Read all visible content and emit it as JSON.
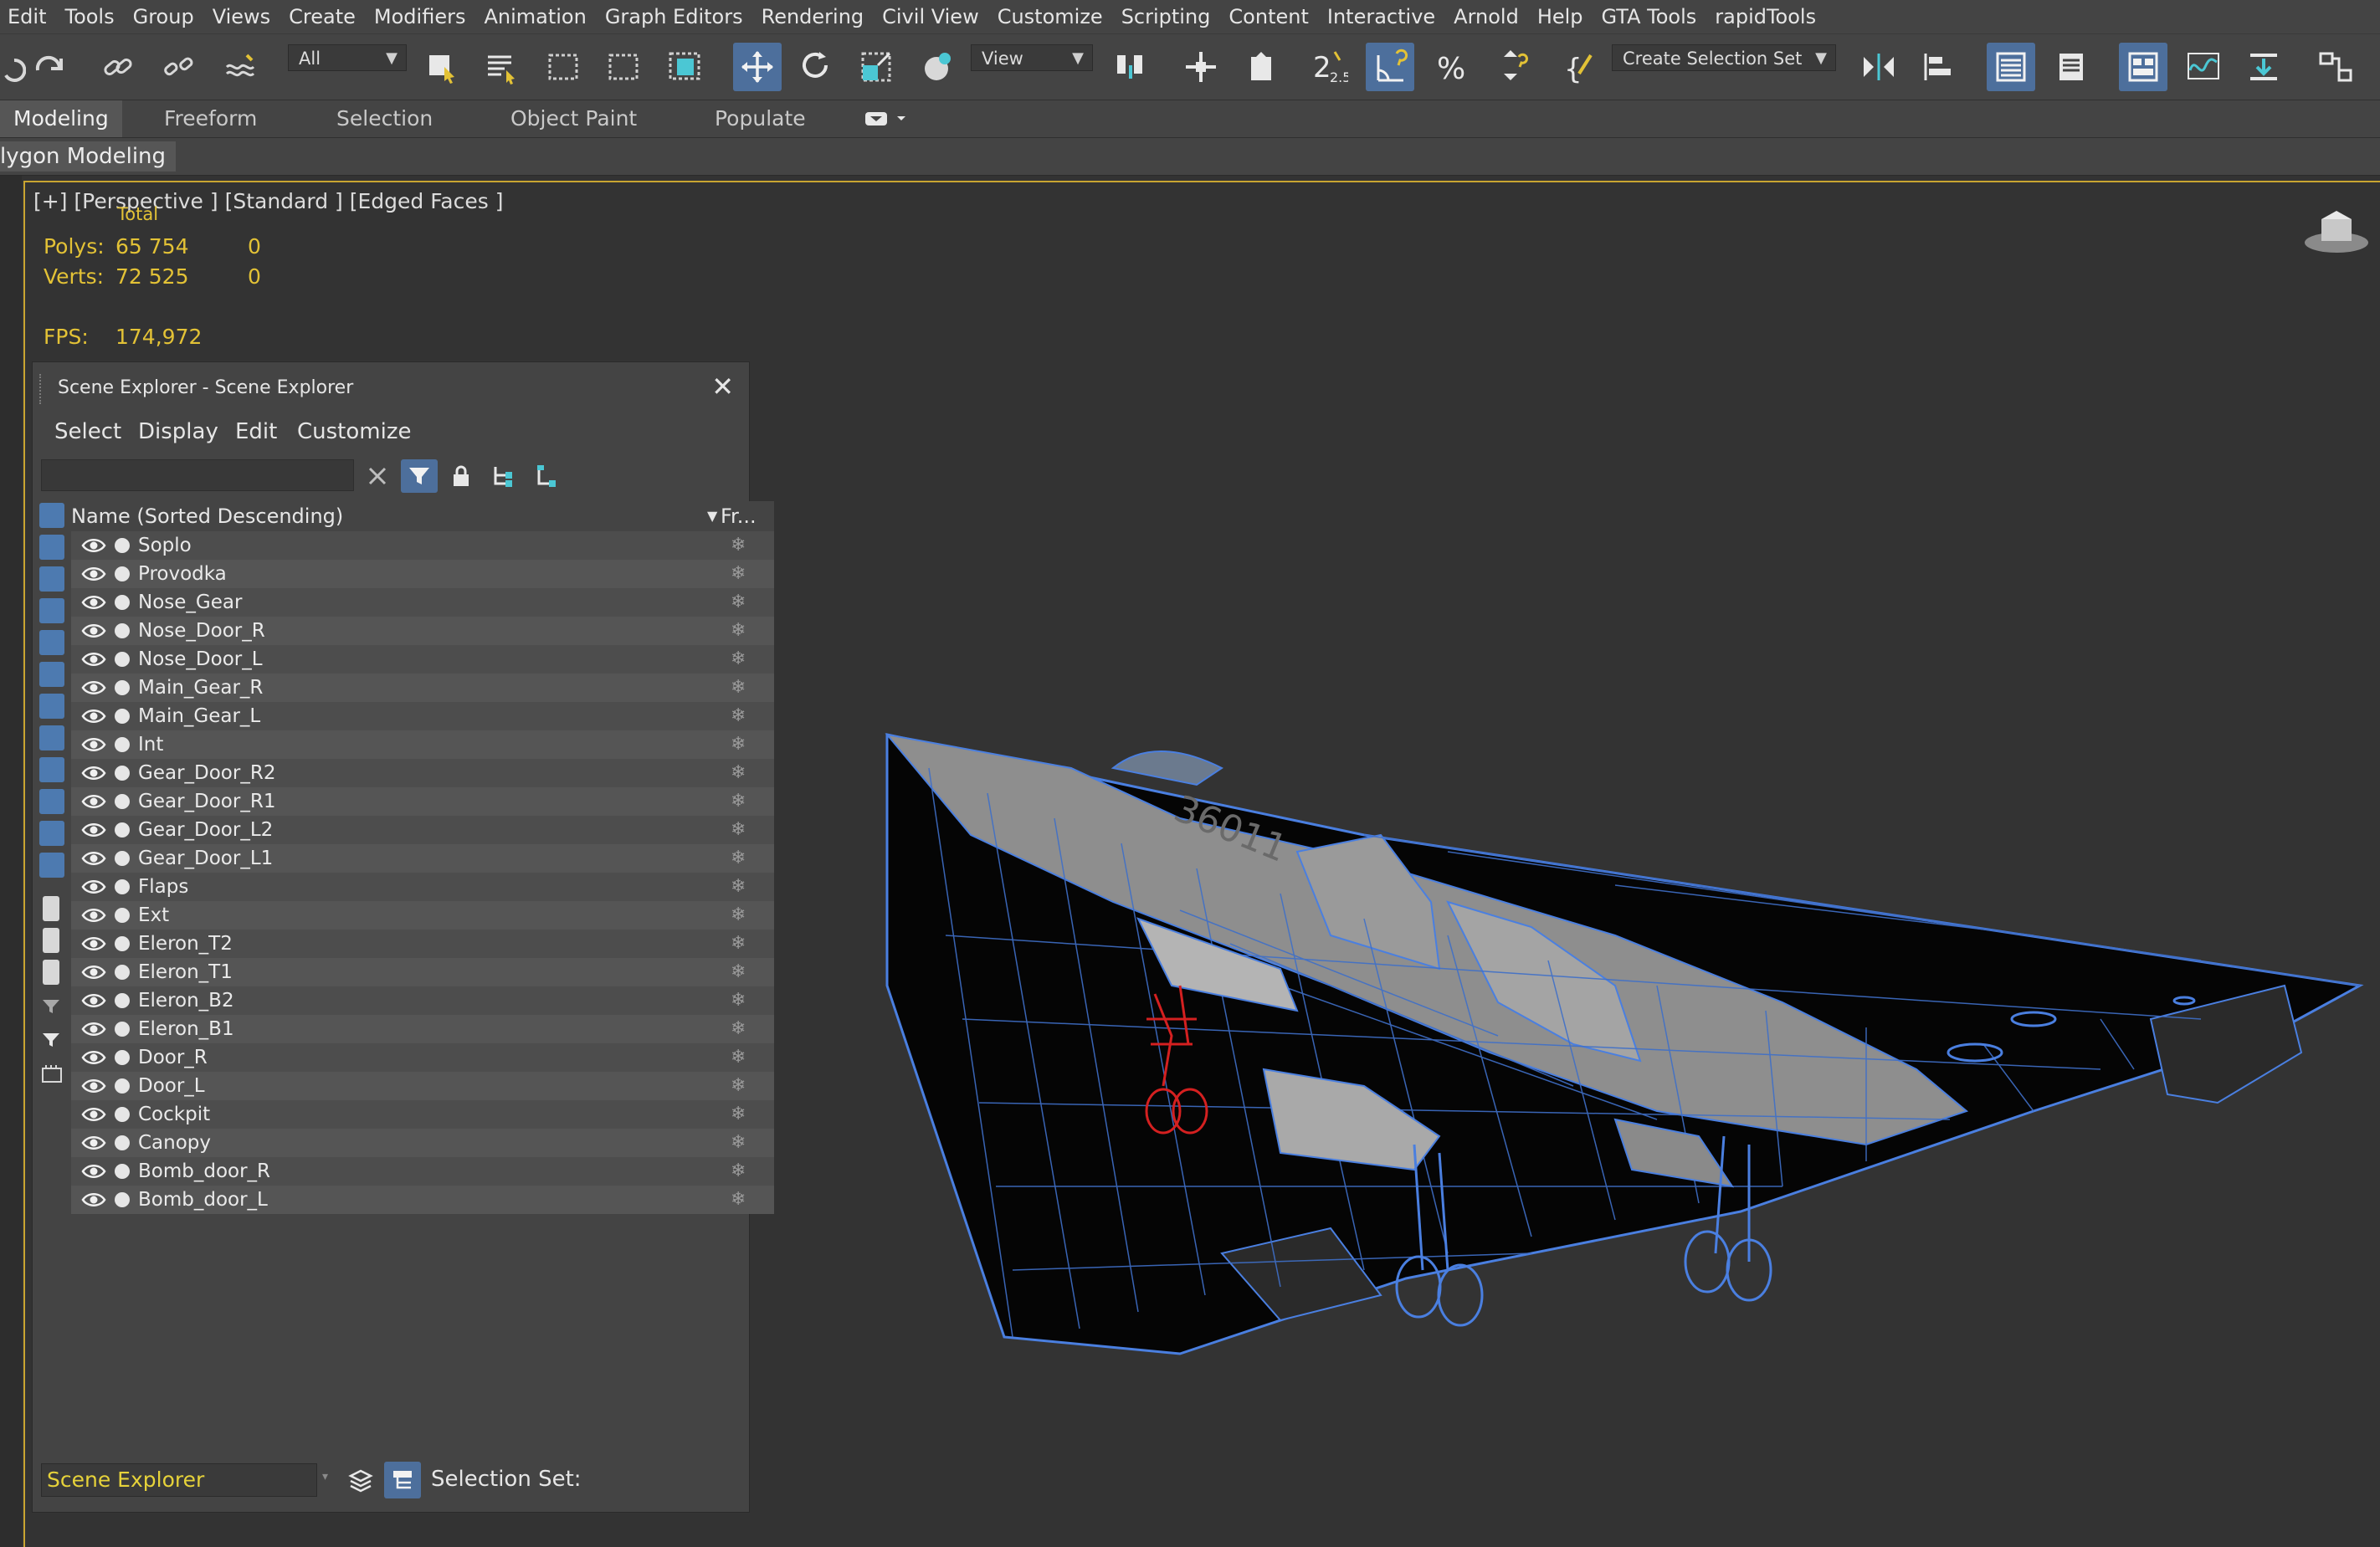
{
  "menu": [
    "Edit",
    "Tools",
    "Group",
    "Views",
    "Create",
    "Modifiers",
    "Animation",
    "Graph Editors",
    "Rendering",
    "Civil View",
    "Customize",
    "Scripting",
    "Content",
    "Interactive",
    "Arnold",
    "Help",
    "GTA Tools",
    "rapidTools"
  ],
  "toolbar": {
    "filter_label": "All",
    "view_label": "View",
    "selection_set_label": "Create Selection Set",
    "snap_label": "2.5"
  },
  "ribbon": {
    "tabs": [
      "Modeling",
      "Freeform",
      "Selection",
      "Object Paint",
      "Populate"
    ],
    "active_tab": "Modeling",
    "sub_label": "lygon Modeling"
  },
  "viewport": {
    "label": "[+] [Perspective ] [Standard ] [Edged Faces ]",
    "stats_header": "Total",
    "polys_label": "Polys:",
    "polys_total": "65 754",
    "polys_sel": "0",
    "verts_label": "Verts:",
    "verts_total": "72 525",
    "verts_sel": "0",
    "fps_label": "FPS:",
    "fps_value": "174,972",
    "stat_color": "#e3c236",
    "model_numbers": "36011"
  },
  "scene_explorer": {
    "title": "Scene Explorer - Scene Explorer",
    "menu": [
      "Select",
      "Display",
      "Edit",
      "Customize"
    ],
    "column_name": "Name (Sorted Descending)",
    "column_frozen": "Fr...",
    "items": [
      "Soplo",
      "Provodka",
      "Nose_Gear",
      "Nose_Door_R",
      "Nose_Door_L",
      "Main_Gear_R",
      "Main_Gear_L",
      "Int",
      "Gear_Door_R2",
      "Gear_Door_R1",
      "Gear_Door_L2",
      "Gear_Door_L1",
      "Flaps",
      "Ext",
      "Eleron_T2",
      "Eleron_T1",
      "Eleron_B2",
      "Eleron_B1",
      "Door_R",
      "Door_L",
      "Cockpit",
      "Canopy",
      "Bomb_door_R",
      "Bomb_door_L"
    ],
    "footer_dropdown": "Scene Explorer",
    "selection_set_label": "Selection Set:"
  },
  "colors": {
    "accent": "#4d6f9c",
    "viewport_border": "#c9a531",
    "wire": "#4a7fe0",
    "selected_wire": "#d42020"
  }
}
